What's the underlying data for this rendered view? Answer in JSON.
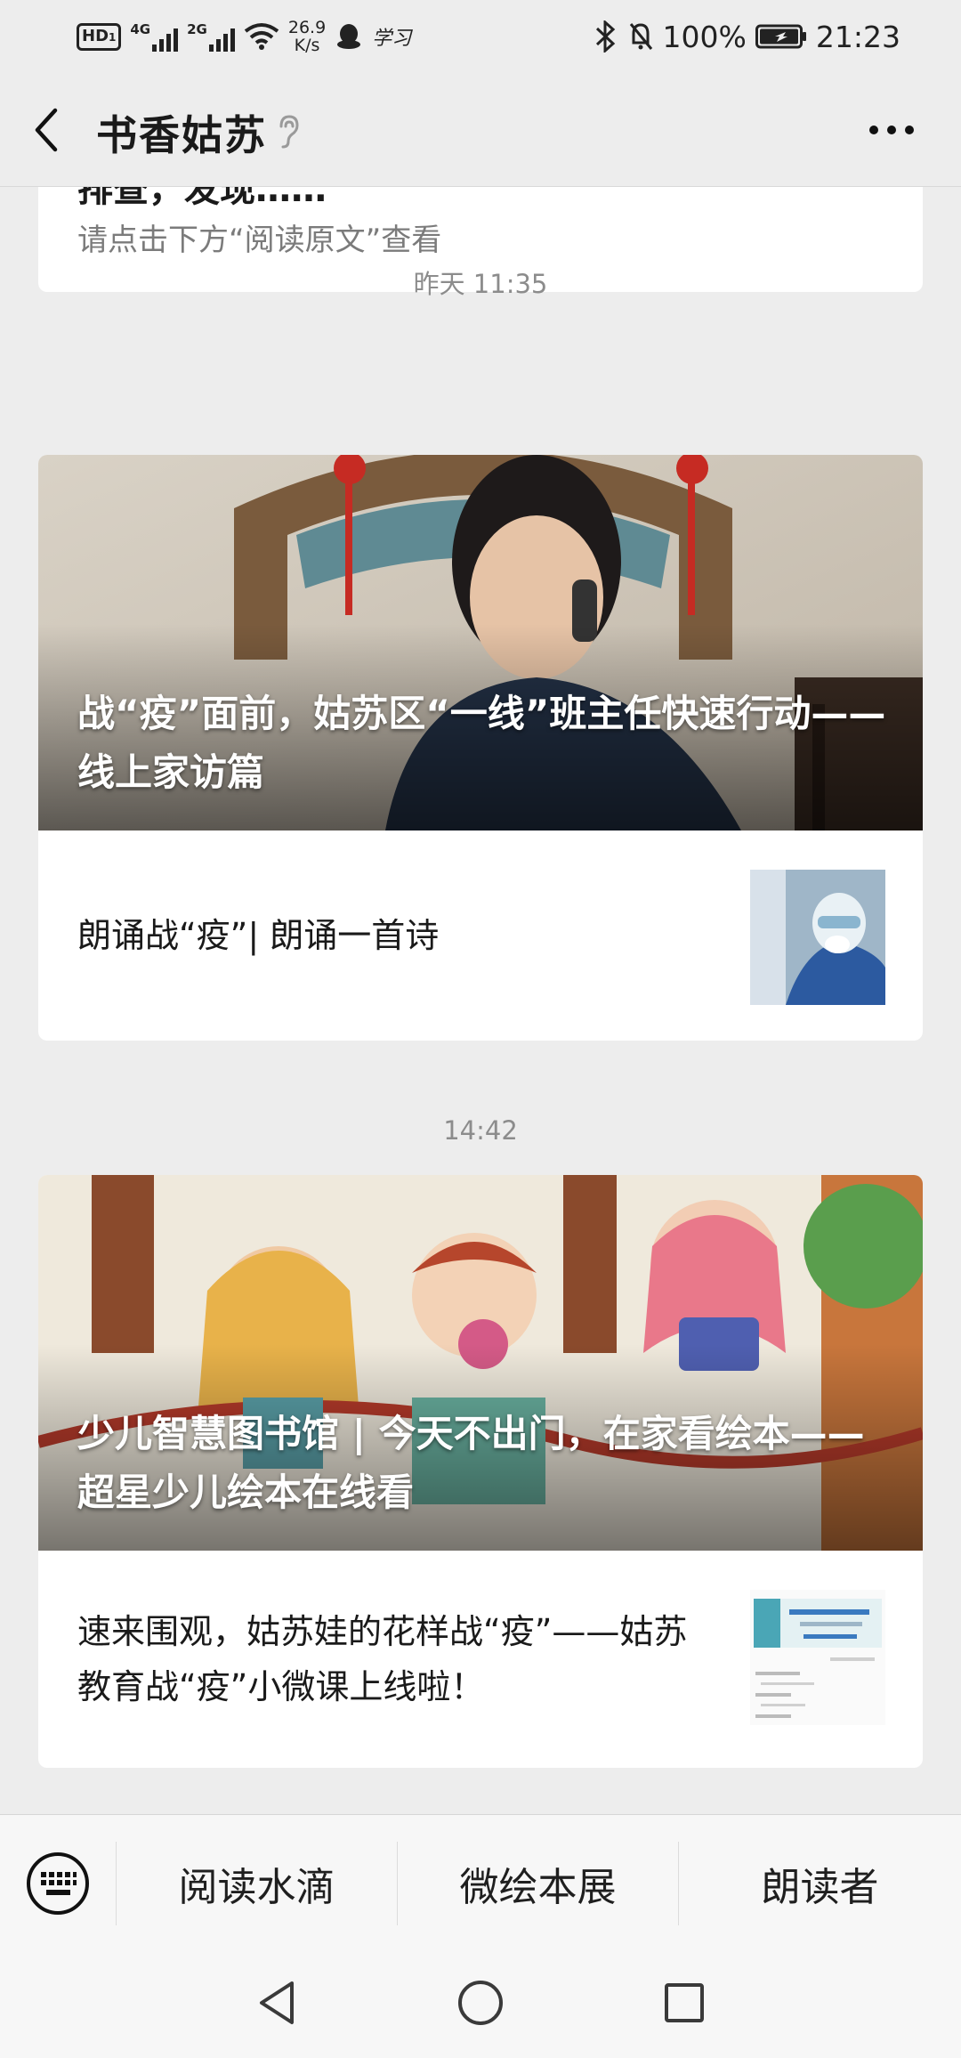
{
  "status_bar": {
    "hd": "HD",
    "hd_sub": "1",
    "net1": "4G",
    "net2": "2G",
    "speed_value": "26.9",
    "speed_unit": "K/s",
    "study_app_text": "学习",
    "battery": "100%",
    "time": "21:23",
    "icons": [
      "hd-icon",
      "signal-icon",
      "wifi-icon",
      "qq-icon",
      "bluetooth-icon",
      "mute-icon",
      "battery-icon"
    ]
  },
  "header": {
    "title": "书香姑苏",
    "icons": [
      "back-icon",
      "ear-icon",
      "more-icon"
    ]
  },
  "feed": {
    "partial_card": {
      "snippet": "排查，发现……",
      "hint": "请点击下方“阅读原文”查看"
    },
    "groups": [
      {
        "time": "昨天 11:35",
        "cover_title": "战“疫”面前，姑苏区“一线”班主任快速行动——线上家访篇",
        "sub_articles": [
          {
            "title": "朗诵战“疫”| 朗诵一首诗"
          }
        ]
      },
      {
        "time": "14:42",
        "cover_title": "少儿智慧图书馆 | 今天不出门，在家看绘本——超星少儿绘本在线看",
        "sub_articles": [
          {
            "title": "速来围观，姑苏娃的花样战“疫”——姑苏教育战“疫”小微课上线啦！"
          }
        ]
      }
    ]
  },
  "bottom_menu": {
    "keyboard_icon": "keyboard-icon",
    "items": [
      "阅读水滴",
      "微绘本展",
      "朗读者"
    ]
  },
  "system_nav": {
    "icons": [
      "nav-back-icon",
      "nav-home-icon",
      "nav-recents-icon"
    ]
  },
  "colors": {
    "background": "#ededed",
    "card": "#ffffff",
    "muted_text": "#8c8c8c"
  }
}
